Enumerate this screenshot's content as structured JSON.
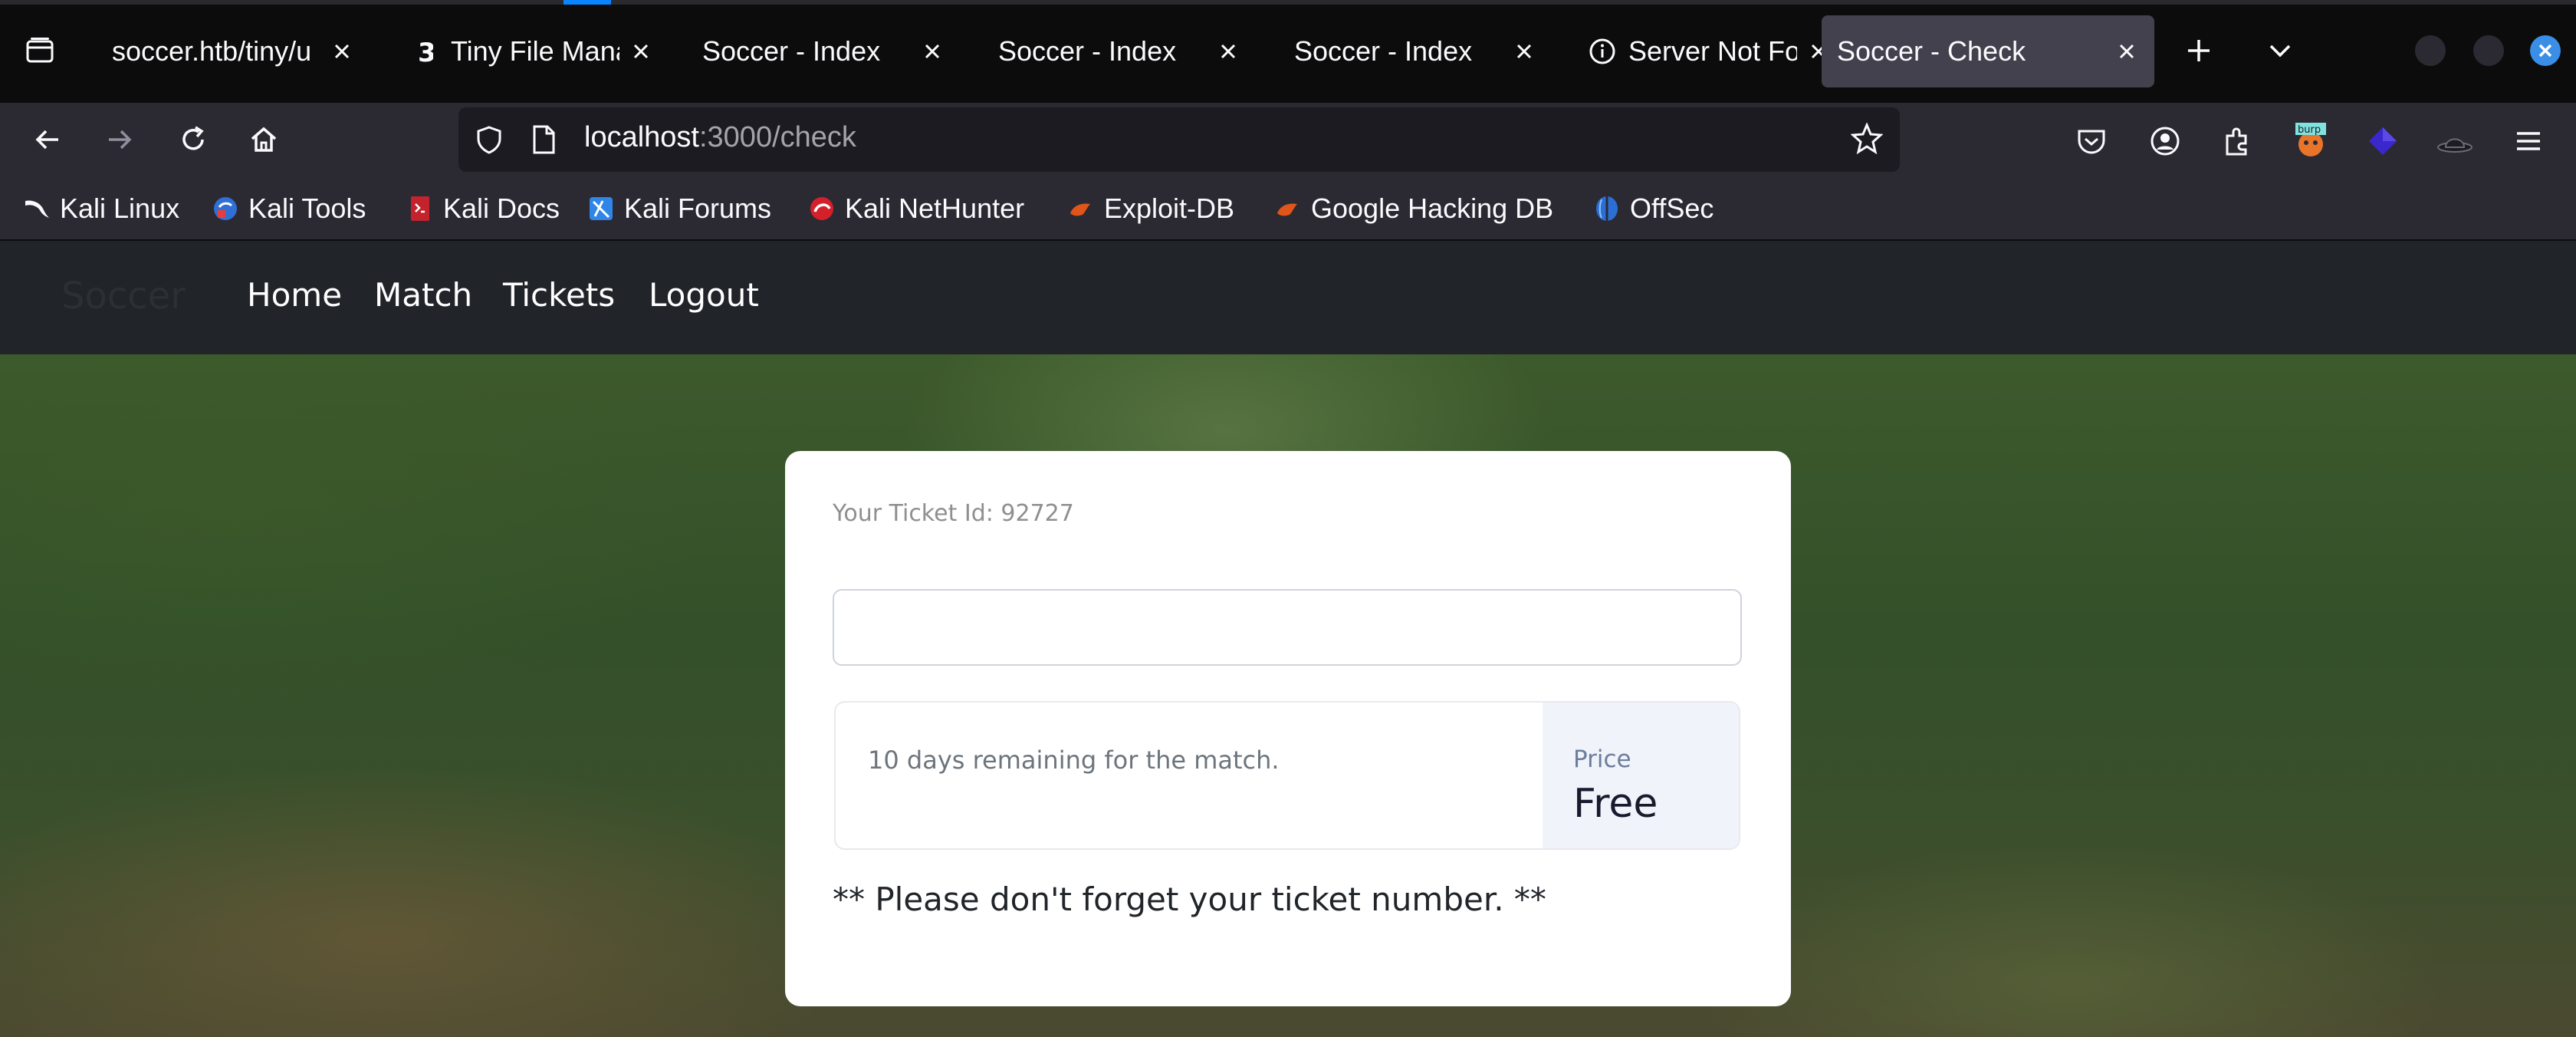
{
  "browser": {
    "tabs": [
      {
        "title": "soccer.htb/tiny/u",
        "icon": "page-icon",
        "active": false
      },
      {
        "title": "Tiny File Mana",
        "icon": "tinyfm-icon",
        "active": false
      },
      {
        "title": "Soccer - Index",
        "icon": "none",
        "active": false
      },
      {
        "title": "Soccer - Index",
        "icon": "none",
        "active": false
      },
      {
        "title": "Soccer - Index",
        "icon": "none",
        "active": false
      },
      {
        "title": "Server Not Fo",
        "icon": "info-icon",
        "active": false
      },
      {
        "title": "Soccer - Check",
        "icon": "none",
        "active": true
      }
    ],
    "url_host": "localhost",
    "url_path": ":3000/check",
    "bookmarks": [
      {
        "label": "Kali Linux",
        "icon": "kali-dragon-icon"
      },
      {
        "label": "Kali Tools",
        "icon": "kali-tools-icon"
      },
      {
        "label": "Kali Docs",
        "icon": "kali-docs-icon"
      },
      {
        "label": "Kali Forums",
        "icon": "kali-forums-icon"
      },
      {
        "label": "Kali NetHunter",
        "icon": "nethunter-icon"
      },
      {
        "label": "Exploit-DB",
        "icon": "exploitdb-icon"
      },
      {
        "label": "Google Hacking DB",
        "icon": "ghdb-icon"
      },
      {
        "label": "OffSec",
        "icon": "offsec-icon"
      }
    ],
    "extension_badge": "burp"
  },
  "site": {
    "brand": "Soccer",
    "nav": [
      "Home",
      "Match",
      "Tickets",
      "Logout"
    ]
  },
  "ticket": {
    "id_label": "Your Ticket Id: 92727",
    "input_value": "",
    "remaining": "10 days remaining for the match.",
    "price_label": "Price",
    "price_value": "Free",
    "reminder": "** Please don't forget your ticket number. **"
  },
  "colors": {
    "accent_tab_indicator": "#0a84ff",
    "site_nav_bg": "#212529",
    "card_bg": "#ffffff",
    "price_pane_bg": "#f0f3fa"
  }
}
